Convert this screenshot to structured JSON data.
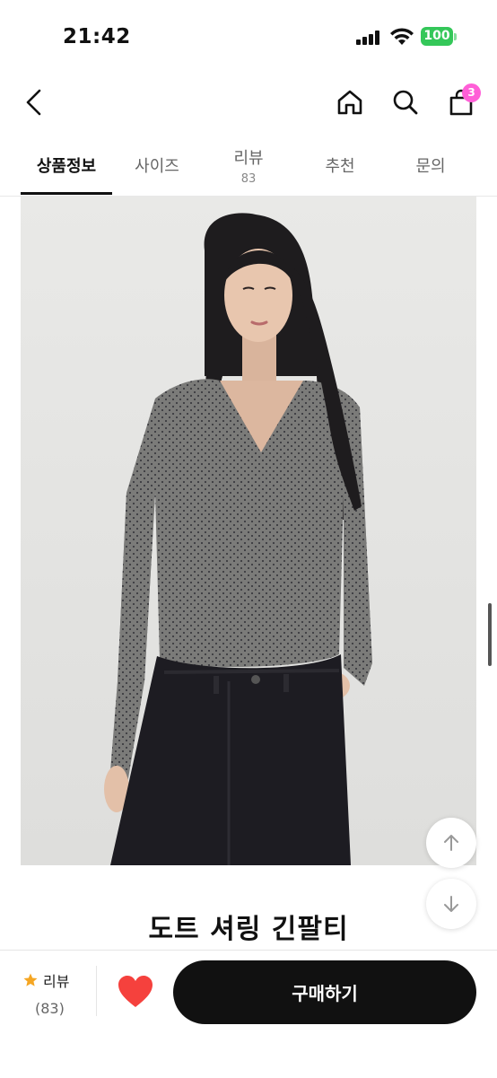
{
  "status_bar": {
    "time": "21:42",
    "battery": "100"
  },
  "nav": {
    "cart_badge": "3"
  },
  "tabs": [
    {
      "label": "상품정보",
      "count": ""
    },
    {
      "label": "사이즈",
      "count": ""
    },
    {
      "label": "리뷰",
      "count": "83"
    },
    {
      "label": "추천",
      "count": ""
    },
    {
      "label": "문의",
      "count": ""
    }
  ],
  "product": {
    "title": "도트 셔링 긴팔티"
  },
  "bottom": {
    "review_label": "리뷰",
    "review_count": "(83)",
    "buy_label": "구매하기"
  },
  "colors": {
    "accent": "#111111",
    "badge": "#ff5fd7",
    "battery": "#34c759",
    "heart": "#f5413d",
    "star": "#f5a623"
  }
}
